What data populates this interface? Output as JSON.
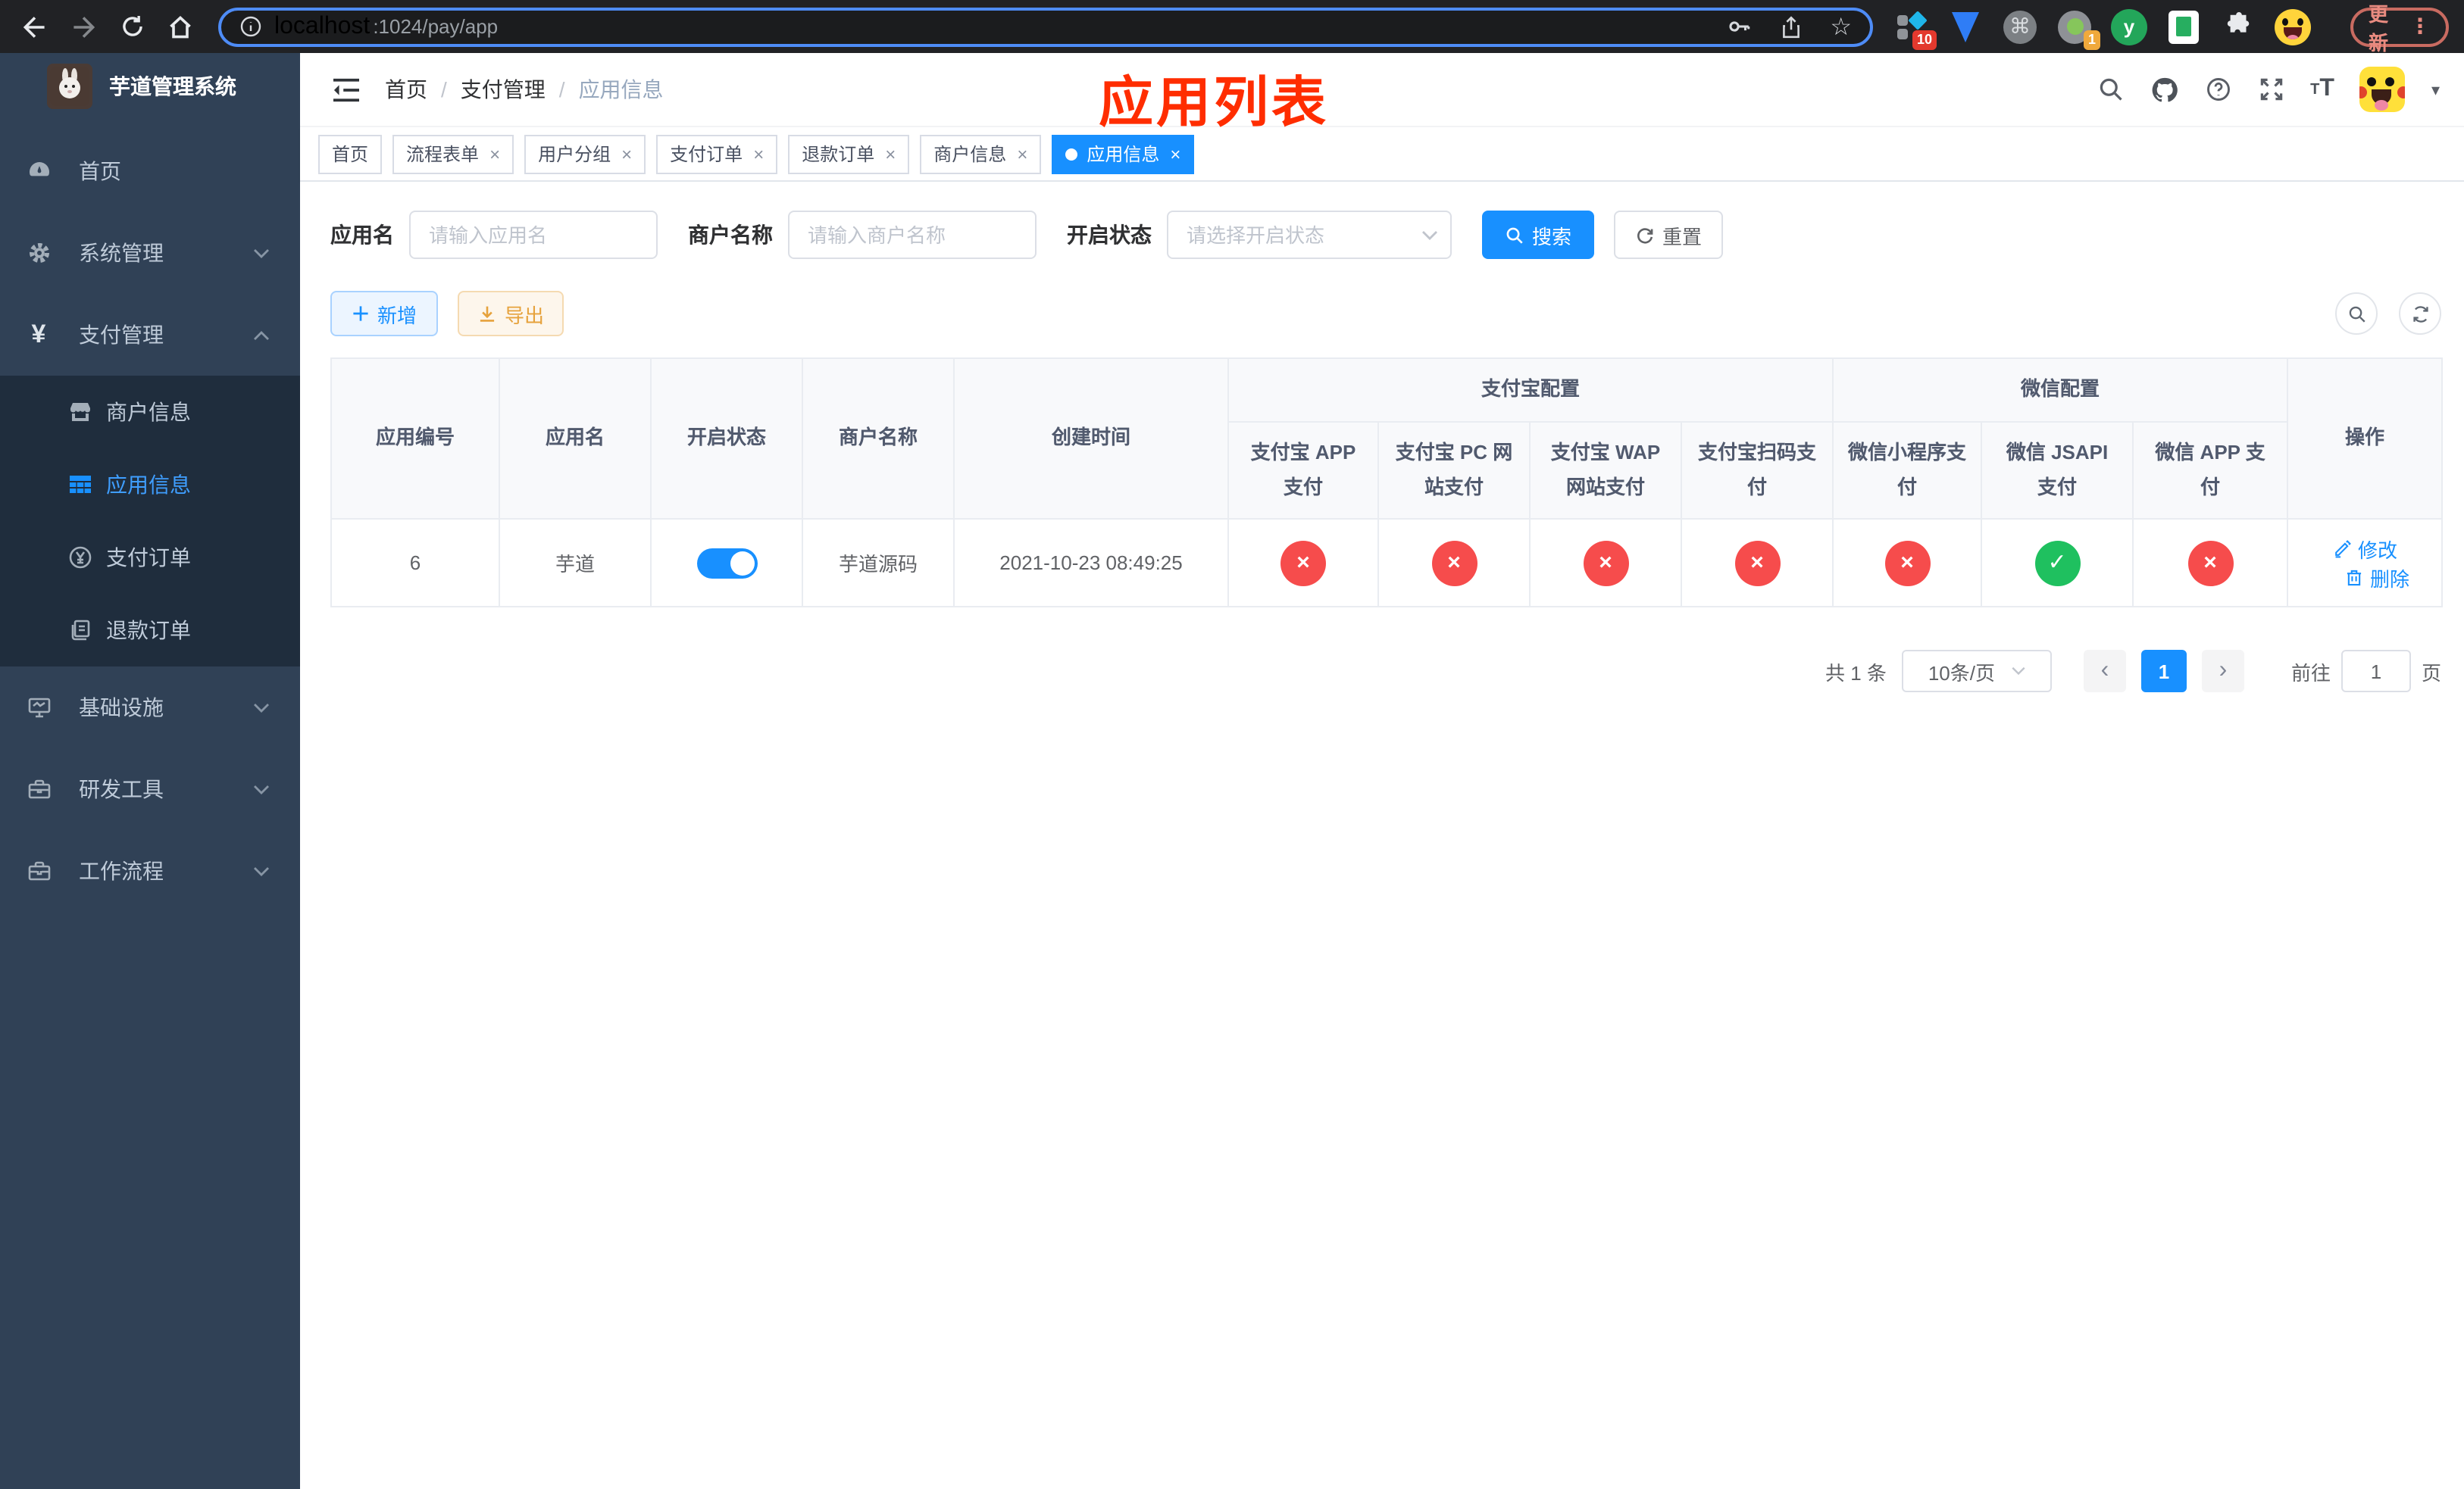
{
  "browser": {
    "url_host": "localhost",
    "url_rest": ":1024/pay/app",
    "update_label": "更新",
    "ext_badge_red": "10",
    "ext_badge_orange": "1",
    "ext_y_label": "y"
  },
  "sidebar": {
    "title": "芋道管理系统",
    "menu": [
      {
        "icon": "dashboard-icon",
        "label": "首页"
      },
      {
        "icon": "gear-icon",
        "label": "系统管理"
      },
      {
        "icon": "yen-icon",
        "label": "支付管理"
      }
    ],
    "submenu": [
      {
        "icon": "shop-icon",
        "label": "商户信息"
      },
      {
        "icon": "grid-icon",
        "label": "应用信息",
        "active": true
      },
      {
        "icon": "yen-circle-icon",
        "label": "支付订单"
      },
      {
        "icon": "documents-icon",
        "label": "退款订单"
      }
    ],
    "menu_lower": [
      {
        "icon": "monitor-icon",
        "label": "基础设施"
      },
      {
        "icon": "toolbox-icon",
        "label": "研发工具"
      },
      {
        "icon": "briefcase-icon",
        "label": "工作流程"
      }
    ]
  },
  "header": {
    "breadcrumb": [
      "首页",
      "支付管理",
      "应用信息"
    ],
    "annotation": "应用列表"
  },
  "tabs": [
    {
      "label": "首页",
      "closable": false,
      "active": false
    },
    {
      "label": "流程表单",
      "closable": true,
      "active": false
    },
    {
      "label": "用户分组",
      "closable": true,
      "active": false
    },
    {
      "label": "支付订单",
      "closable": true,
      "active": false
    },
    {
      "label": "退款订单",
      "closable": true,
      "active": false
    },
    {
      "label": "商户信息",
      "closable": true,
      "active": false
    },
    {
      "label": "应用信息",
      "closable": true,
      "active": true
    }
  ],
  "filters": {
    "app_name_label": "应用名",
    "app_name_placeholder": "请输入应用名",
    "merchant_label": "商户名称",
    "merchant_placeholder": "请输入商户名称",
    "status_label": "开启状态",
    "status_placeholder": "请选择开启状态",
    "search_label": "搜索",
    "reset_label": "重置"
  },
  "toolbar": {
    "add_label": "新增",
    "export_label": "导出"
  },
  "table": {
    "cols_left": [
      "应用编号",
      "应用名",
      "开启状态",
      "商户名称",
      "创建时间"
    ],
    "group_alipay": "支付宝配置",
    "group_wechat": "微信配置",
    "cols_alipay": [
      "支付宝 APP 支付",
      "支付宝 PC 网站支付",
      "支付宝 WAP 网站支付",
      "支付宝扫码支付"
    ],
    "cols_wechat": [
      "微信小程序支付",
      "微信 JSAPI 支付",
      "微信 APP 支付"
    ],
    "col_actions": "操作",
    "row": {
      "id": "6",
      "name": "芋道",
      "enabled": true,
      "merchant": "芋道源码",
      "created_at": "2021-10-23 08:49:25",
      "statuses": [
        false,
        false,
        false,
        false,
        false,
        true,
        false
      ]
    },
    "actions": {
      "edit": "修改",
      "delete": "删除"
    }
  },
  "pagination": {
    "total": "共 1 条",
    "page_size": "10条/页",
    "current_page": "1",
    "goto_label": "前往",
    "goto_value": "1",
    "unit_label": "页"
  },
  "icons": {
    "check": "✓",
    "cross": "×",
    "star": "☆",
    "command": "⌘",
    "caret": "▾",
    "prev": "‹",
    "next": "›",
    "dots": "⋮",
    "slash": "/",
    "close": "×",
    "plus": "+"
  },
  "colors": {
    "primary": "#1890ff",
    "success": "#1fc05f",
    "danger": "#f64c4c",
    "warning": "#e6a23c",
    "sidebar_bg": "#304156",
    "submenu_bg": "#1f2d3d",
    "annotation_red": "#ff2d00",
    "browser_bar": "#212225"
  }
}
